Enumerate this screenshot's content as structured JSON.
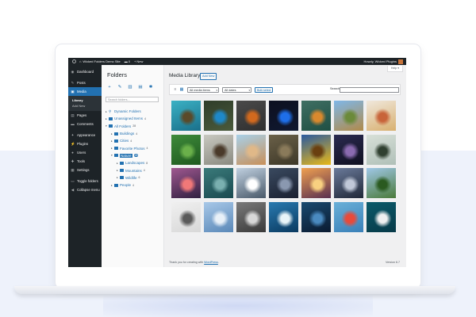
{
  "adminbar": {
    "site_name": "Wicked Folders Demo Site",
    "comments_count": "0",
    "new_label": "New",
    "greeting": "Howdy, Wicked Plugins"
  },
  "menu": {
    "items": [
      {
        "label": "Dashboard",
        "icon": "dashboard-icon",
        "glyph": "◉"
      },
      {
        "label": "Posts",
        "icon": "pin-icon",
        "glyph": "✎"
      },
      {
        "label": "Media",
        "icon": "media-icon",
        "glyph": "▣"
      },
      {
        "label": "Pages",
        "icon": "pages-icon",
        "glyph": "▤"
      },
      {
        "label": "Comments",
        "icon": "comments-icon",
        "glyph": "▬"
      },
      {
        "label": "Appearance",
        "icon": "appearance-icon",
        "glyph": "✦"
      },
      {
        "label": "Plugins",
        "icon": "plugins-icon",
        "glyph": "⚡"
      },
      {
        "label": "Users",
        "icon": "users-icon",
        "glyph": "●"
      },
      {
        "label": "Tools",
        "icon": "tools-icon",
        "glyph": "✚"
      },
      {
        "label": "Settings",
        "icon": "settings-icon",
        "glyph": "▦"
      },
      {
        "label": "Toggle folders",
        "icon": "folder-toggle-icon",
        "glyph": "▭"
      },
      {
        "label": "Collapse menu",
        "icon": "collapse-icon",
        "glyph": "◀"
      }
    ],
    "media_sub": [
      "Library",
      "Add New"
    ]
  },
  "folders": {
    "title": "Folders",
    "search_placeholder": "Search folders...",
    "tree": [
      {
        "label": "Dynamic Folders",
        "count": ""
      },
      {
        "label": "Unassigned Items",
        "count": "4"
      },
      {
        "label": "All Folders",
        "count": "28"
      },
      {
        "label": "Buildings",
        "count": "4"
      },
      {
        "label": "Cities",
        "count": "4"
      },
      {
        "label": "Favorite Photos",
        "count": "4"
      },
      {
        "label": "Nature",
        "count": "28"
      },
      {
        "label": "Landscapes",
        "count": "8"
      },
      {
        "label": "Mountains",
        "count": "4"
      },
      {
        "label": "Wildlife",
        "count": "6"
      },
      {
        "label": "People",
        "count": "4"
      }
    ]
  },
  "library": {
    "title": "Media Library",
    "add_new": "Add New",
    "help": "Help",
    "filter_type": "All media items",
    "filter_date": "All dates",
    "bulk_select": "Bulk select",
    "search_label": "Search",
    "search_value": "",
    "images": [
      {
        "name": "sea-turtle",
        "c1": "#3bb1c4",
        "c2": "#1a6f8a",
        "accent": "#5a4a2a"
      },
      {
        "name": "kingfisher",
        "c1": "#2f3d2a",
        "c2": "#4a5a3b",
        "accent": "#1e88c8"
      },
      {
        "name": "fox",
        "c1": "#4a4a4a",
        "c2": "#2f2f2f",
        "accent": "#d2691e"
      },
      {
        "name": "snake",
        "c1": "#0d1020",
        "c2": "#101830",
        "accent": "#1e6ee8"
      },
      {
        "name": "tiger",
        "c1": "#3f6f63",
        "c2": "#1f4f43",
        "accent": "#d9892e"
      },
      {
        "name": "mountain-valley",
        "c1": "#7fb7e8",
        "c2": "#b08a4a",
        "accent": "#6b8a3a"
      },
      {
        "name": "flower-field",
        "c1": "#f0e8dc",
        "c2": "#d8b070",
        "accent": "#c8643a"
      },
      {
        "name": "monstera-leaf",
        "c1": "#3e8a3a",
        "c2": "#1f5a1f",
        "accent": "#6ab04a"
      },
      {
        "name": "owl",
        "c1": "#c8c8c0",
        "c2": "#8a8a80",
        "accent": "#4a3a2a"
      },
      {
        "name": "desert-dunes",
        "c1": "#a8d0e8",
        "c2": "#c8905a",
        "accent": "#e0b888"
      },
      {
        "name": "elephant",
        "c1": "#6a6048",
        "c2": "#3e3828",
        "accent": "#8a7a5a"
      },
      {
        "name": "sunflower",
        "c1": "#2a5aa0",
        "c2": "#e8b818",
        "accent": "#6a4010"
      },
      {
        "name": "night-sky",
        "c1": "#2a2a50",
        "c2": "#101020",
        "accent": "#8a6ab0"
      },
      {
        "name": "mist-bird",
        "c1": "#d8e0d8",
        "c2": "#b0c0b8",
        "accent": "#304030"
      },
      {
        "name": "pink-sunset",
        "c1": "#a05890",
        "c2": "#302040",
        "accent": "#f07878"
      },
      {
        "name": "succulent",
        "c1": "#3a7a7a",
        "c2": "#1a4a50",
        "accent": "#7ab0b0"
      },
      {
        "name": "snowy-peaks",
        "c1": "#c0d0e0",
        "c2": "#4a5a6a",
        "accent": "#ffffff"
      },
      {
        "name": "forest-fog",
        "c1": "#3a4a60",
        "c2": "#1a2030",
        "accent": "#8a98b0"
      },
      {
        "name": "lake-sunset",
        "c1": "#f0a050",
        "c2": "#5a3050",
        "accent": "#f8d080"
      },
      {
        "name": "volcano-night",
        "c1": "#6a7a9a",
        "c2": "#202838",
        "accent": "#c0c8d8"
      },
      {
        "name": "lone-tree",
        "c1": "#a0c8e8",
        "c2": "#4a7a3a",
        "accent": "#2a5a20"
      },
      {
        "name": "liberty-statue",
        "c1": "#f0f0f0",
        "c2": "#d8d8d8",
        "accent": "#5a5a5a"
      },
      {
        "name": "blue-mountains",
        "c1": "#a8c8e8",
        "c2": "#5a88b8",
        "accent": "#e8f0f8"
      },
      {
        "name": "frost-pattern",
        "c1": "#7a7a7a",
        "c2": "#3a3a3a",
        "accent": "#d8d8d8"
      },
      {
        "name": "ocean-wave",
        "c1": "#2a7ab0",
        "c2": "#0a3a60",
        "accent": "#e8f4f8"
      },
      {
        "name": "underwater",
        "c1": "#1a4a70",
        "c2": "#0a1a30",
        "accent": "#4a8ac0"
      },
      {
        "name": "hot-air-balloons",
        "c1": "#6ab0d8",
        "c2": "#3a80b8",
        "accent": "#e84a3a"
      },
      {
        "name": "coastal-road",
        "c1": "#0a5a6a",
        "c2": "#083a48",
        "accent": "#f0f0f0"
      },
      {
        "name": "alpine-lake",
        "c1": "#e8a0b0",
        "c2": "#2a7a8a",
        "accent": "#6a9a8a"
      }
    ]
  },
  "footer": {
    "thanks_prefix": "Thank you for creating with ",
    "wordpress_link": "WordPress",
    "thanks_suffix": ".",
    "version": "Version 6.7"
  }
}
